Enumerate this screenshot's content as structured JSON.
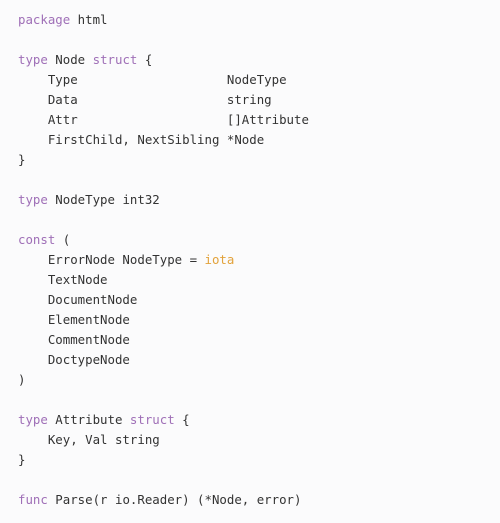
{
  "code": {
    "tokens": [
      {
        "t": "package",
        "c": "kw"
      },
      {
        "t": " html\n\n",
        "c": "name"
      },
      {
        "t": "type",
        "c": "kw"
      },
      {
        "t": " Node ",
        "c": "name"
      },
      {
        "t": "struct",
        "c": "kw"
      },
      {
        "t": " {\n",
        "c": "name"
      },
      {
        "t": "    Type                    NodeType\n",
        "c": "name"
      },
      {
        "t": "    Data                    string\n",
        "c": "name"
      },
      {
        "t": "    Attr                    []Attribute\n",
        "c": "name"
      },
      {
        "t": "    FirstChild, NextSibling *Node\n",
        "c": "name"
      },
      {
        "t": "}\n\n",
        "c": "name"
      },
      {
        "t": "type",
        "c": "kw"
      },
      {
        "t": " NodeType int32\n\n",
        "c": "name"
      },
      {
        "t": "const",
        "c": "kw"
      },
      {
        "t": " (\n",
        "c": "name"
      },
      {
        "t": "    ErrorNode NodeType = ",
        "c": "name"
      },
      {
        "t": "iota",
        "c": "builtin"
      },
      {
        "t": "\n",
        "c": "name"
      },
      {
        "t": "    TextNode\n",
        "c": "name"
      },
      {
        "t": "    DocumentNode\n",
        "c": "name"
      },
      {
        "t": "    ElementNode\n",
        "c": "name"
      },
      {
        "t": "    CommentNode\n",
        "c": "name"
      },
      {
        "t": "    DoctypeNode\n",
        "c": "name"
      },
      {
        "t": ")\n\n",
        "c": "name"
      },
      {
        "t": "type",
        "c": "kw"
      },
      {
        "t": " Attribute ",
        "c": "name"
      },
      {
        "t": "struct",
        "c": "kw"
      },
      {
        "t": " {\n",
        "c": "name"
      },
      {
        "t": "    Key, Val string\n",
        "c": "name"
      },
      {
        "t": "}\n\n",
        "c": "name"
      },
      {
        "t": "func",
        "c": "kw"
      },
      {
        "t": " Parse(r io.Reader) (*Node, error)",
        "c": "name"
      }
    ]
  }
}
